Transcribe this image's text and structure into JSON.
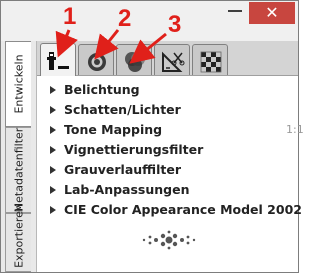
{
  "window": {
    "minimize_glyph": "—",
    "close_glyph": "✕"
  },
  "sidebar": {
    "tabs": [
      {
        "label": "Entwickeln",
        "active": true
      },
      {
        "label": "Metadatenfilter",
        "active": false
      },
      {
        "label": "Exportieren",
        "active": false
      }
    ]
  },
  "toolbar": {
    "tabs": [
      {
        "icon": "exposure-icon",
        "active": true
      },
      {
        "icon": "detail-icon",
        "active": false
      },
      {
        "icon": "color-icon",
        "active": false
      },
      {
        "icon": "transform-icon",
        "active": false
      },
      {
        "icon": "raw-icon",
        "active": false
      }
    ]
  },
  "tools": [
    {
      "label": "Belichtung"
    },
    {
      "label": "Schatten/Lichter"
    },
    {
      "label": "Tone Mapping",
      "note": "1:1"
    },
    {
      "label": "Vignettierungsfilter"
    },
    {
      "label": "Grauverlauffilter"
    },
    {
      "label": "Lab-Anpassungen"
    },
    {
      "label": "CIE Color Appearance Model 2002"
    }
  ],
  "callouts": [
    "1",
    "2",
    "3"
  ],
  "colors": {
    "callout": "#e0201a",
    "window_bg": "#f0f0f0",
    "panel_bg": "#ffffff"
  }
}
